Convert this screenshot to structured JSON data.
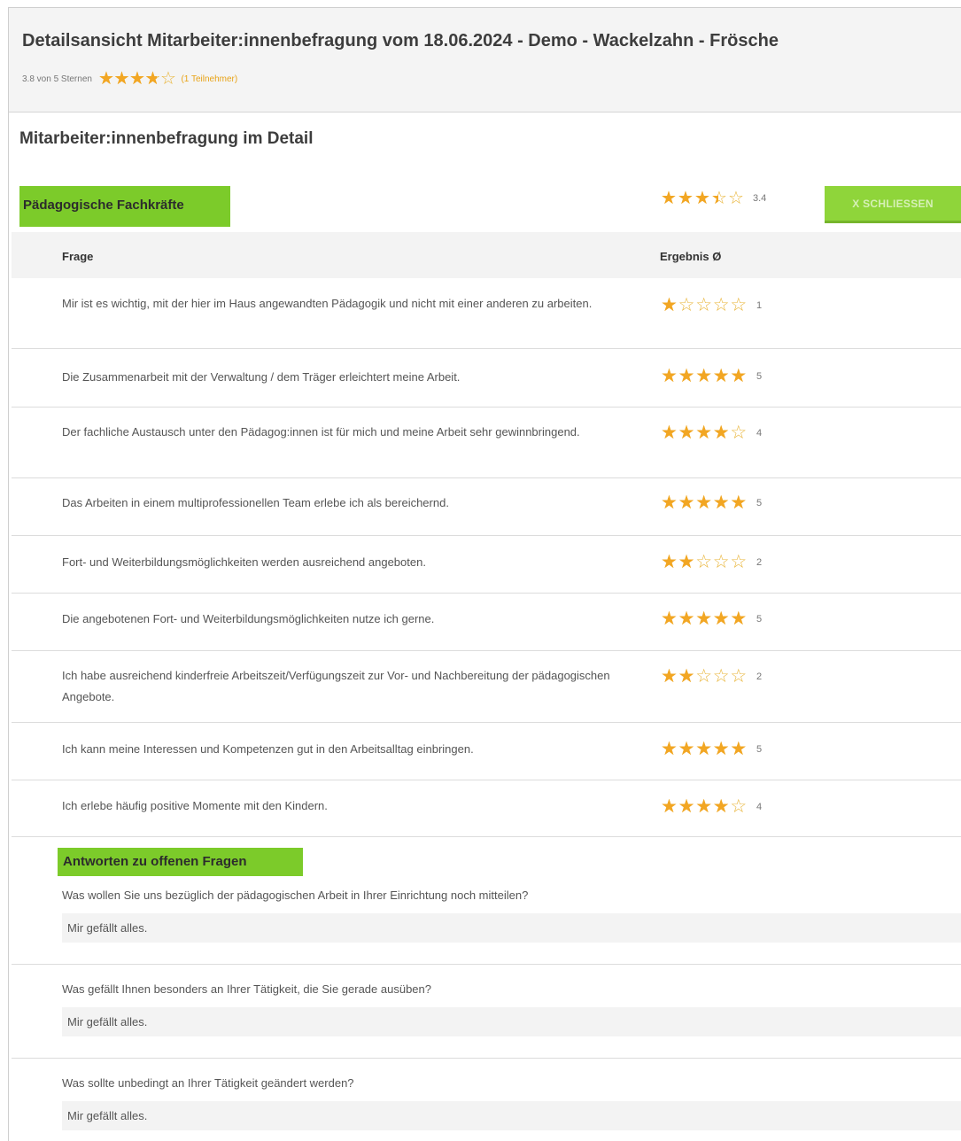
{
  "header": {
    "title": "Detailsansicht Mitarbeiter:innenbefragung vom 18.06.2024 - Demo - Wackelzahn - Frösche",
    "rating_text": "3.8 von 5 Sternen",
    "rating": 3.8,
    "participants": "(1 Teilnehmer)"
  },
  "section_title": "Mitarbeiter:innenbefragung im Detail",
  "group": {
    "label": "Pädagogische Fachkräfte",
    "average": 3.4,
    "average_text": "3.4",
    "close_label": "X SCHLIESSEN"
  },
  "table": {
    "col_question": "Frage",
    "col_result": "Ergebnis Ø",
    "rows": [
      {
        "question": "Mir ist es wichtig, mit der hier im Haus angewandten Pädagogik und nicht mit einer anderen zu arbeiten.",
        "score": 1,
        "score_text": "1"
      },
      {
        "question": "Die Zusammenarbeit mit der Verwaltung / dem Träger erleichtert meine Arbeit.",
        "score": 5,
        "score_text": "5"
      },
      {
        "question": "Der fachliche Austausch unter den Pädagog:innen ist für mich und meine Arbeit sehr gewinnbringend.",
        "score": 4,
        "score_text": "4"
      },
      {
        "question": "Das Arbeiten in einem multiprofessionellen Team erlebe ich als bereichernd.",
        "score": 5,
        "score_text": "5"
      },
      {
        "question": "Fort- und Weiterbildungsmöglichkeiten werden ausreichend angeboten.",
        "score": 2,
        "score_text": "2"
      },
      {
        "question": "Die angebotenen Fort- und Weiterbildungsmöglichkeiten nutze ich gerne.",
        "score": 5,
        "score_text": "5"
      },
      {
        "question": "Ich habe ausreichend kinderfreie Arbeitszeit/Verfügungszeit zur Vor- und Nachbereitung der pädagogischen Angebote.",
        "score": 2,
        "score_text": "2"
      },
      {
        "question": "Ich kann meine Interessen und Kompetenzen gut in den Arbeitsalltag einbringen.",
        "score": 5,
        "score_text": "5"
      },
      {
        "question": "Ich erlebe häufig positive Momente mit den Kindern.",
        "score": 4,
        "score_text": "4"
      }
    ]
  },
  "open_questions": {
    "label": "Antworten zu offenen Fragen",
    "items": [
      {
        "question": "Was wollen Sie uns bezüglich der pädagogischen Arbeit in Ihrer Einrichtung noch mitteilen?",
        "answer": "Mir gefällt alles."
      },
      {
        "question": "Was gefällt Ihnen besonders an Ihrer Tätigkeit, die Sie gerade ausüben?",
        "answer": "Mir gefällt alles."
      },
      {
        "question": "Was sollte unbedingt an Ihrer Tätigkeit geändert werden?",
        "answer": "Mir gefällt alles."
      }
    ]
  },
  "colors": {
    "accent_green": "#7ccb2a",
    "star_orange": "#f2a623"
  }
}
